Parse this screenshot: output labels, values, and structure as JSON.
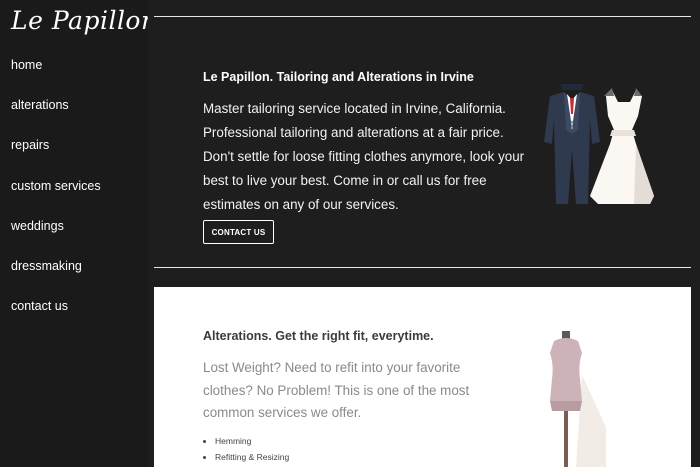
{
  "brand": {
    "logo_text": "Le Papillon"
  },
  "sidebar": {
    "items": [
      {
        "label": "home"
      },
      {
        "label": "alterations"
      },
      {
        "label": "repairs"
      },
      {
        "label": "custom services"
      },
      {
        "label": "weddings"
      },
      {
        "label": "dressmaking"
      },
      {
        "label": "contact us"
      }
    ]
  },
  "hero": {
    "title": "Le Papillon. Tailoring and Alterations in Irvine",
    "text": "Master tailoring service located in Irvine, California. Professional tailoring and alterations at a fair price. Don't settle for loose fitting clothes anymore, look your best to live your best. Come in or call us for free estimates on any of our services.",
    "button_label": "CONTACT US",
    "illustration": "suit-and-wedding-dress-icon"
  },
  "alterations": {
    "title": "Alterations. Get the right fit, everytime.",
    "text": "Lost Weight? Need to refit into your favorite clothes? No Problem! This is one of the most common services we offer.",
    "list": [
      {
        "label": "Hemming"
      },
      {
        "label": "Refitting & Resizing"
      }
    ],
    "illustration": "dress-form-mannequin-icon"
  },
  "colors": {
    "background": "#1e1e1e",
    "sidebar": "#1a1a1a",
    "panel": "#ffffff",
    "rule": "#e6e6e6",
    "muted_text": "#8a8a8a"
  }
}
